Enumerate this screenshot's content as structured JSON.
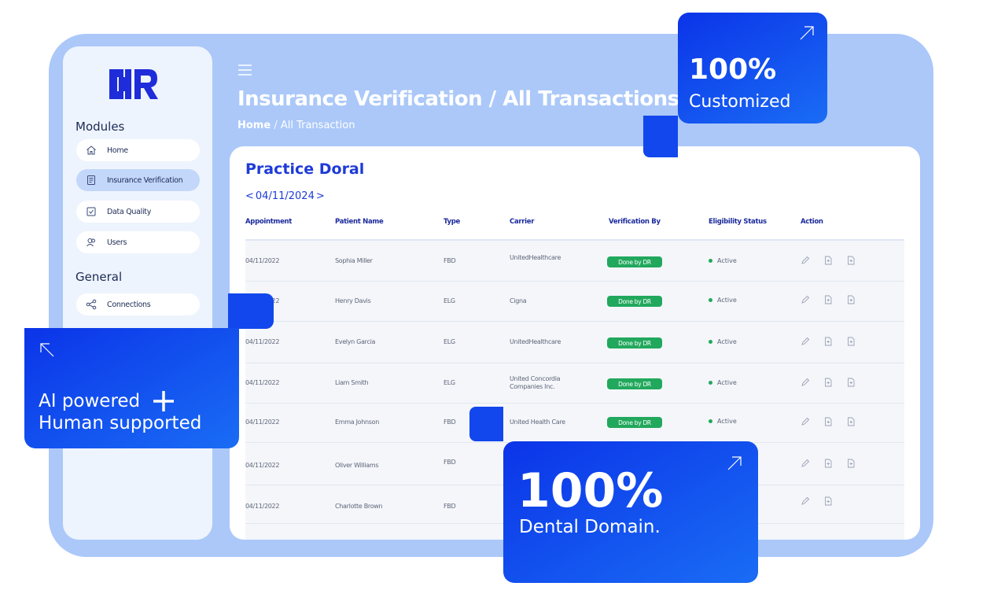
{
  "sidebar": {
    "logo_text": "DR",
    "modules_title": "Modules",
    "general_title": "General",
    "items": [
      {
        "label": "Home",
        "icon": "home-icon"
      },
      {
        "label": "Insurance Verification",
        "icon": "document-icon",
        "active": true
      },
      {
        "label": "Data Quality",
        "icon": "checkbox-icon"
      },
      {
        "label": "Users",
        "icon": "users-icon"
      }
    ],
    "general_items": [
      {
        "label": "Connections",
        "icon": "share-icon"
      }
    ]
  },
  "header": {
    "title": "Insurance Verification / All Transactions",
    "breadcrumb_home": "Home",
    "breadcrumb_current": "All Transaction"
  },
  "practice": {
    "name": "Practice Doral",
    "prev": "<",
    "date": "04/11/2024",
    "next": ">"
  },
  "table": {
    "columns": [
      "Appointment",
      "Patient Name",
      "Type",
      "Carrier",
      "Verification By",
      "Eligibility Status",
      "Action"
    ],
    "rows": [
      {
        "appointment": "04/11/2022",
        "patient": "Sophia Miller",
        "type": "FBD",
        "carrier": "UnitedHealthcare",
        "verification": "Done by DR",
        "status": "Active"
      },
      {
        "appointment": "04/11/2022",
        "patient": "Henry Davis",
        "type": "ELG",
        "carrier": "Cigna",
        "verification": "Done by DR",
        "status": "Active"
      },
      {
        "appointment": "04/11/2022",
        "patient": "Evelyn Garcia",
        "type": "ELG",
        "carrier": "UnitedHealthcare",
        "verification": "Done by DR",
        "status": "Active"
      },
      {
        "appointment": "04/11/2022",
        "patient": "Liam Smith",
        "type": "ELG",
        "carrier": "United Concordia Companies Inc.",
        "verification": "Done by DR",
        "status": "Active"
      },
      {
        "appointment": "04/11/2022",
        "patient": "Emma Johnson",
        "type": "FBD",
        "carrier": "United Health Care",
        "verification": "Done by DR",
        "status": "Active"
      },
      {
        "appointment": "04/11/2022",
        "patient": "Oliver Williams",
        "type": "FBD",
        "carrier": "",
        "verification": "",
        "status": ""
      },
      {
        "appointment": "04/11/2022",
        "patient": "Charlotte Brown",
        "type": "FBD",
        "carrier": "",
        "verification": "",
        "status": ""
      }
    ]
  },
  "badges": {
    "customized": {
      "big": "100%",
      "small": "Customized"
    },
    "ai": {
      "line1": "AI powered",
      "line2": "Human supported"
    },
    "dental": {
      "big": "100%",
      "small": "Dental Domain."
    }
  },
  "colors": {
    "accent": "#1e3ad8",
    "frame": "#abc8f9",
    "success": "#21a85c",
    "card": "#0b34e8"
  }
}
